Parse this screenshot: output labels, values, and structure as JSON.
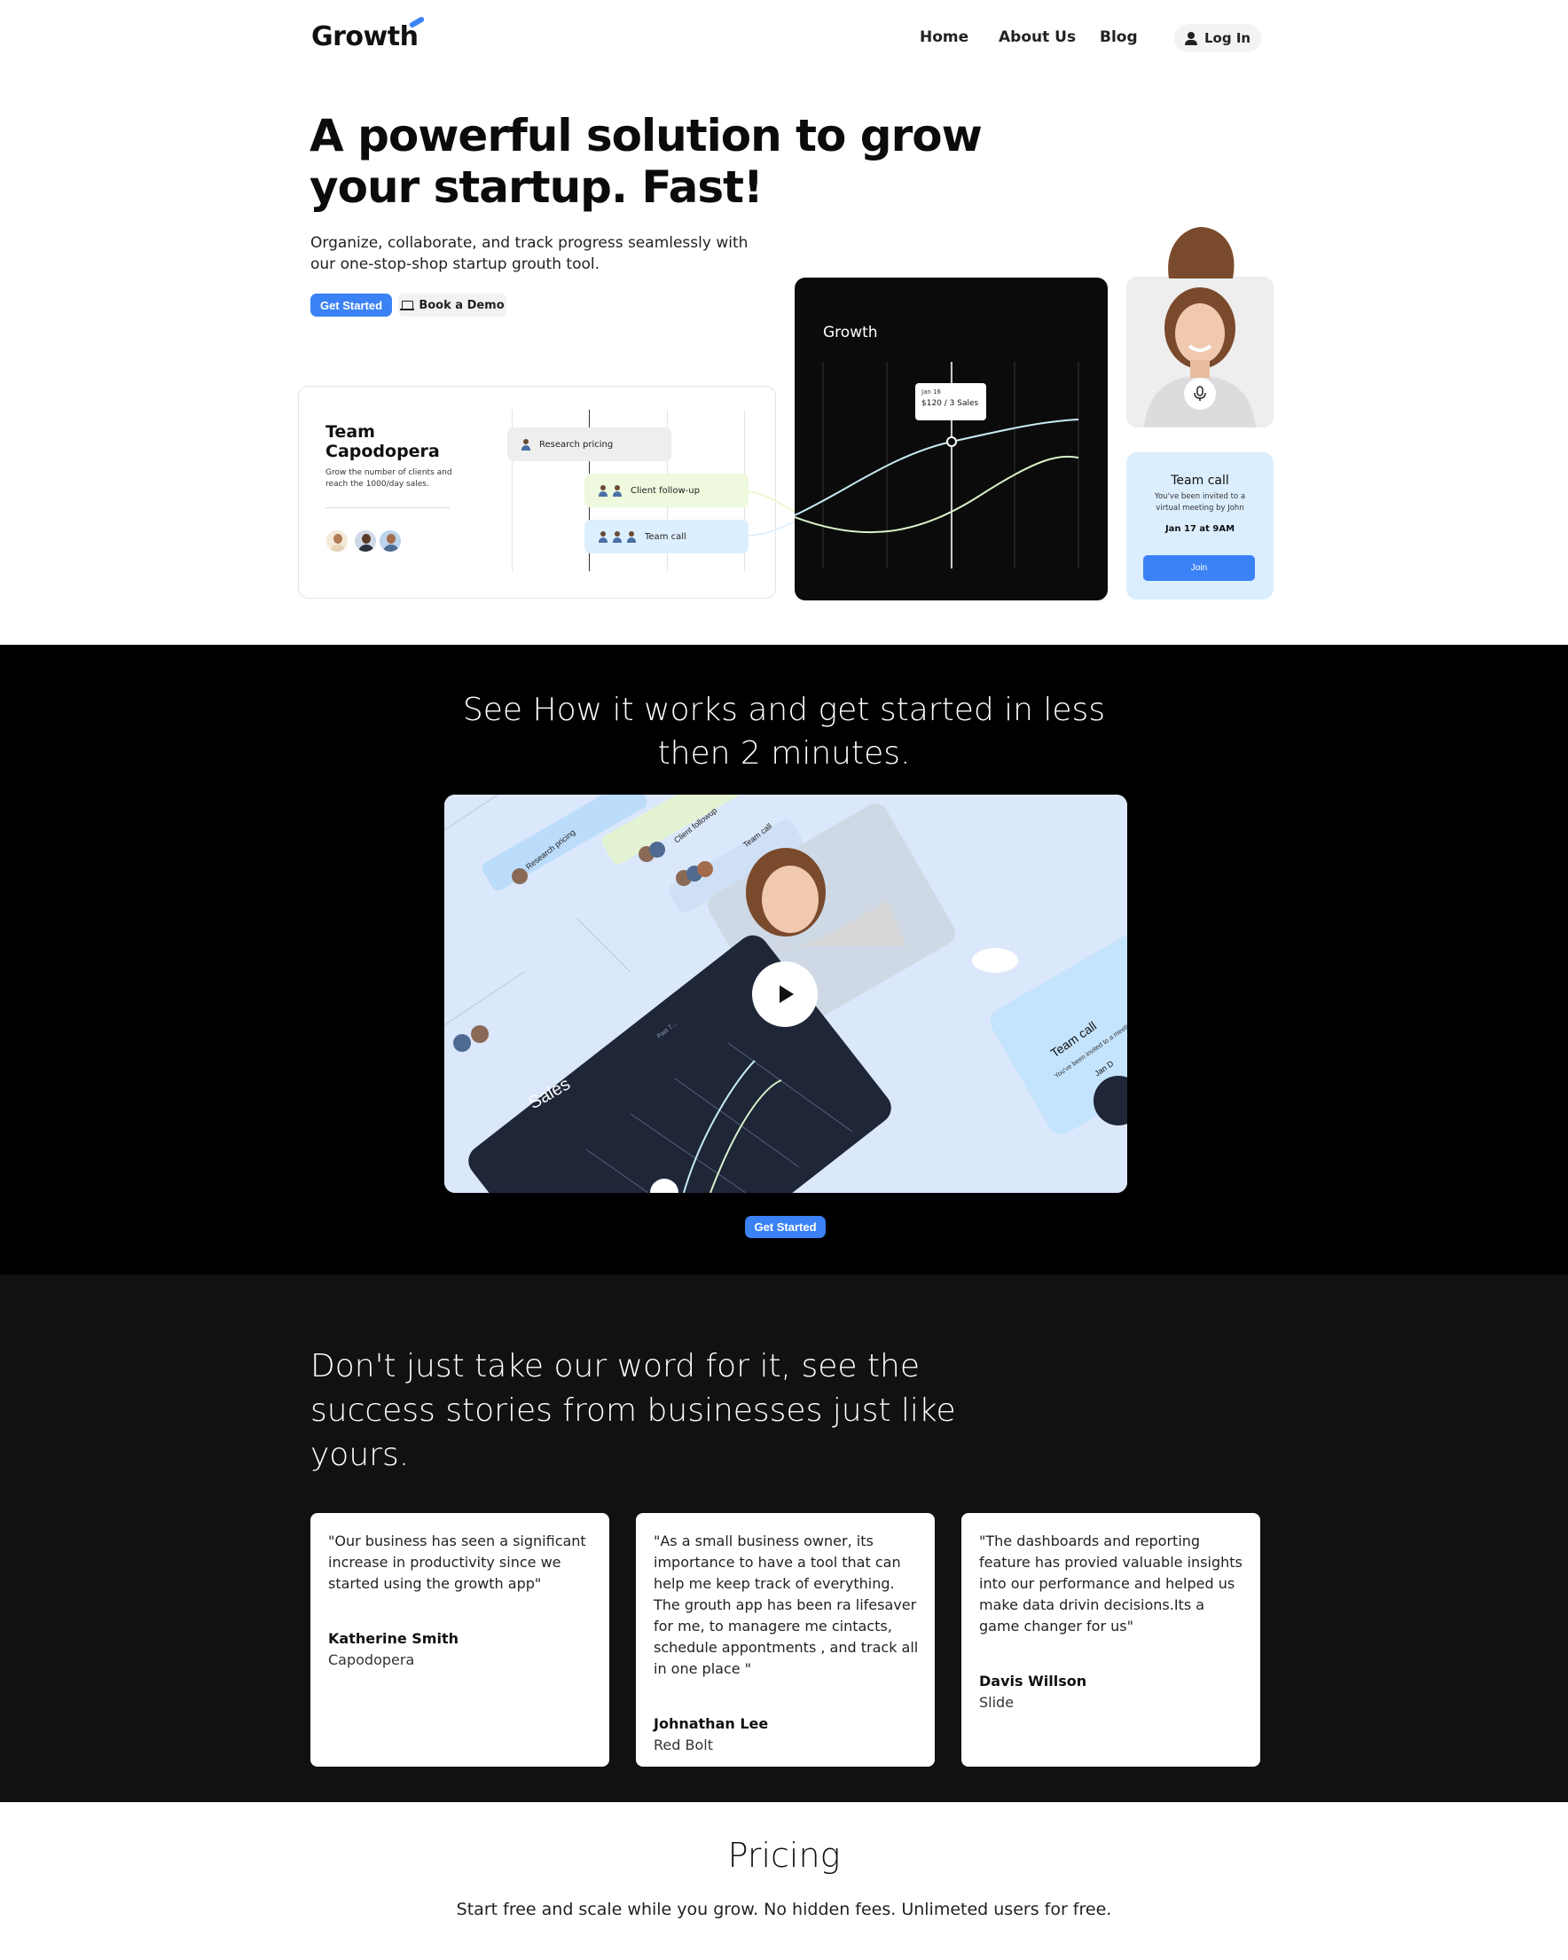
{
  "nav": {
    "logo": "Growth",
    "links": [
      "Home",
      "About Us",
      "Blog"
    ],
    "login": "Log In"
  },
  "hero": {
    "title": "A powerful solution to grow your startup. Fast!",
    "subtitle": "Organize, collaborate, and track progress seamlessly with our one-stop-shop startup grouth tool.",
    "cta_primary": "Get Started",
    "cta_secondary": "Book a Demo"
  },
  "team_card": {
    "title": "Team Capodopera",
    "description": "Grow the number of clients and reach the 1000/day sales.",
    "tasks": [
      "Research pricing",
      "Client follow-up",
      "Team call"
    ]
  },
  "growth_card": {
    "label": "Growth",
    "tooltip_date": "Jan 16",
    "tooltip_value": "$120 / 3 Sales"
  },
  "call_card": {
    "title": "Team call",
    "description": "You've been invited to a virtual meeting by John",
    "date": "Jan 17 at 9AM",
    "button": "Join"
  },
  "how": {
    "title": "See How it works and get started in less then 2 minutes.",
    "video_labels": [
      "Research pricing",
      "Client followup",
      "Team call",
      "Sales",
      "Team call",
      "You've been invited to a meeting by Jo",
      "Jan D",
      "Past 7..."
    ],
    "cta": "Get Started"
  },
  "testimonials": {
    "title": "Don't just take our word for it, see the success stories from businesses just like yours.",
    "items": [
      {
        "quote": "\"Our business has seen a significant increase in productivity since we started using the growth app\"",
        "name": "Katherine Smith",
        "company": "Capodopera"
      },
      {
        "quote": "\"As a small business owner, its importance to have a tool that can help me keep track of everything. The grouth app has been ra lifesaver for me, to managere me cintacts, schedule appontments , and track all in one place \"",
        "name": "Johnathan Lee",
        "company": "Red Bolt"
      },
      {
        "quote": "\"The dashboards and reporting feature has provied valuable insights into our performance and helped us make data drivin decisions.Its a game changer for us\"",
        "name": "Davis Willson",
        "company": "Slide"
      }
    ]
  },
  "pricing": {
    "title": "Pricing",
    "subtitle": "Start free and scale while you grow. No hidden fees. Unlimeted users for free."
  },
  "colors": {
    "accent": "#3b82f6",
    "dark": "#111111",
    "call_card_bg": "#dbeefe"
  }
}
